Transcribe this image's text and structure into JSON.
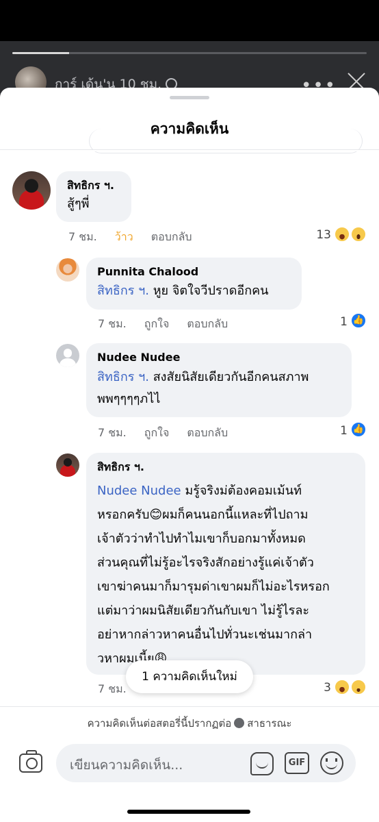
{
  "story": {
    "author_and_time": "การ์ เด้น'น 10 ชม.",
    "progress": 0.16
  },
  "sheet": {
    "title": "ความคิดเห็น"
  },
  "comments": [
    {
      "author": "สิทธิกร ฯ.",
      "text": "สู้ๆพี่",
      "meta": {
        "time": "7 ชม.",
        "reaction_label": "ว้าว",
        "reply_label": "ตอบกลับ"
      },
      "reaction_count": "13",
      "reactions": [
        "haha-icon",
        "wow-icon"
      ],
      "replies": [
        {
          "author": "Punnita Chalood",
          "mention": "สิทธิกร ฯ.",
          "text": " หูย จิตใจวีปราดอีกคน",
          "meta": {
            "time": "7 ชม.",
            "like_label": "ถูกใจ",
            "reply_label": "ตอบกลับ"
          },
          "reaction_count": "1",
          "reactions": [
            "like-icon"
          ]
        },
        {
          "author": "Nudee Nudee",
          "mention": "สิทธิกร ฯ.",
          "text_lines": [
            " สงสัยนิสัยเดียวกันอีกคนสภาพ",
            "พพๆๆๆๆภไไ"
          ],
          "meta": {
            "time": "7 ชม.",
            "like_label": "ถูกใจ",
            "reply_label": "ตอบกลับ"
          },
          "reaction_count": "1",
          "reactions": [
            "like-icon"
          ]
        },
        {
          "author": "สิทธิกร ฯ.",
          "mention": "Nudee Nudee",
          "text_lines": [
            " มรู้จริงม่ต้องคอมเม้นท์",
            "หรอกครับ😊ผมก็คนนอกนี้แหละที่ไปถาม",
            "เจ้าตัวว่าทำไปทำไมเขาก็บอกมาทั้งหมด",
            "ส่วนคุณที่ไม่รู้อะไรจริงสักอย่างรู้แค่เจ้าตัว",
            "เขาฆ่าคนมาก็มารุมด่าเขาผมก็ไม่อะไรหรอก",
            "แต่มาว่าผมนิสัยเดียวกันกับเขา ไม่รู้ไรละ",
            "อย่าหากล่าวหาคนอื่นไปทั่วนะเช่นมากล่า",
            "วหาผมเนี้ย😩"
          ],
          "meta": {
            "time": "7 ชม."
          },
          "reaction_count": "3",
          "reactions": [
            "haha-icon",
            "sad-icon"
          ]
        }
      ]
    }
  ],
  "new_comments_pill": "1 ความคิดเห็นใหม่",
  "footer": {
    "audience_prefix": "ความคิดเห็นต่อสตอรี่นี้ปรากฏต่อ",
    "audience_value": "สาธารณะ",
    "input_placeholder": "เขียนความคิดเห็น...",
    "gif_label": "GIF"
  }
}
